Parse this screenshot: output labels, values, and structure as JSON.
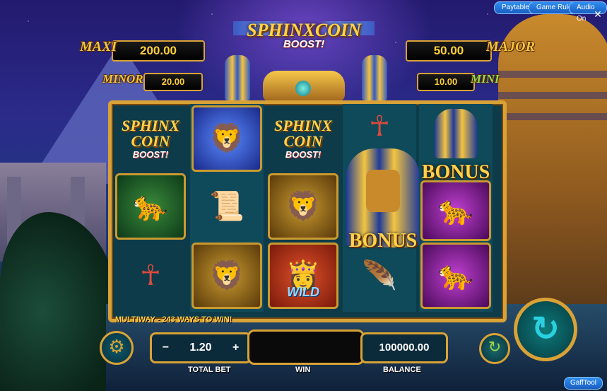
{
  "top_bar": {
    "paytable_label": "Paytable",
    "game_rules_label": "Game Rules",
    "audio_label": "Audio On",
    "close_glyph": "✕"
  },
  "logo": {
    "line1": "SPHINXCOIN",
    "line2": "BOOST!"
  },
  "jackpots": {
    "maxi": {
      "label": "MAXI",
      "value": "200.00"
    },
    "major": {
      "label": "MAJOR",
      "value": "50.00"
    },
    "minor": {
      "label": "MINOR",
      "value": "20.00"
    },
    "mini": {
      "label": "MINI",
      "value": "10.00"
    }
  },
  "reels": {
    "sphinx_line1": "SPHINX",
    "sphinx_line2": "COIN",
    "sphinx_line3": "BOOST!",
    "bonus_label": "BONUS",
    "wild_label": "WILD",
    "icons": {
      "white_lion": "white-lion-icon",
      "leopard": "leopard-icon",
      "scroll": "scroll-icon",
      "ankh": "ankh-fan-icon",
      "lion": "lion-icon",
      "cheetah": "cheetah-icon",
      "feather": "peacock-feather-icon",
      "pharaoh": "pharaoh-icon",
      "queen": "egyptian-queen-icon"
    },
    "glyphs": {
      "white_lion": "🦁",
      "leopard": "🐆",
      "scroll": "📜",
      "ankh": "☥",
      "lion": "🦁",
      "cheetah": "🐆",
      "feather": "🪶",
      "queen": "👸"
    }
  },
  "bottom": {
    "ways_text": "MULTIWAY - 243 WAYS TO WIN!",
    "settings_glyph": "⚙",
    "minus": "−",
    "bet_value": "1.20",
    "plus": "+",
    "win_value": "",
    "balance_value": "100000.00",
    "total_bet_label": "TOTAL BET",
    "win_label": "WIN",
    "balance_label": "BALANCE",
    "auto_glyph": "↻",
    "spin_glyph": "↻",
    "gafftool_label": "GaffTool"
  },
  "colors": {
    "gold": "#d9a236",
    "jackpot_text": "#ffcf3a",
    "button_blue": "#2f8ff0",
    "spin_teal": "#0e7a7a"
  }
}
